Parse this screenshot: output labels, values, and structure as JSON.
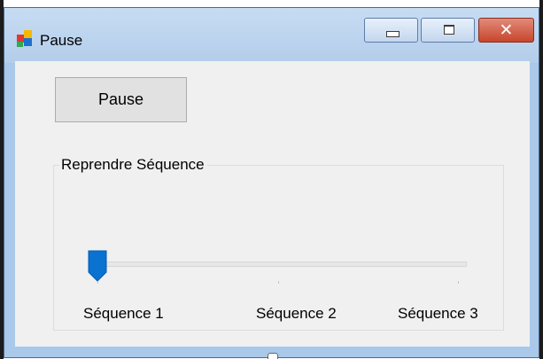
{
  "window": {
    "title": "Pause",
    "controls": {
      "minimize": "minimize",
      "maximize": "maximize",
      "close": "✕"
    }
  },
  "main": {
    "pause_button_label": "Pause",
    "group_title": "Reprendre Séquence",
    "slider": {
      "value": 1,
      "min": 1,
      "max": 3,
      "ticks": [
        "Séquence 1",
        "Séquence 2",
        "Séquence 3"
      ]
    }
  },
  "colors": {
    "thumb": "#0a72d1",
    "close_button": "#c8452b",
    "client_bg": "#f0f0f0"
  }
}
